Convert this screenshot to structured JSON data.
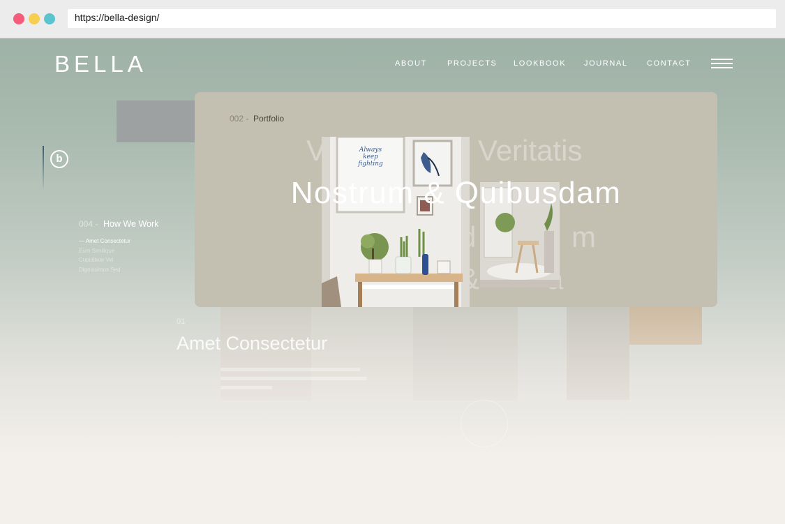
{
  "browser": {
    "url": "https://bella-design/",
    "dot_colors": [
      "#f45c7a",
      "#f7ce4f",
      "#5cc4cf"
    ]
  },
  "header": {
    "logo": "BELLA",
    "nav": [
      "ABOUT",
      "PROJECTS",
      "LOOKBOOK",
      "JOURNAL",
      "CONTACT"
    ],
    "menu_icon": "hamburger-icon"
  },
  "side": {
    "logo_letter": "b"
  },
  "how_we_work": {
    "number": "004 -",
    "title": "How We Work",
    "items": [
      "— Amet Consectetur",
      "Eum Similique",
      "Cupiditate Vel",
      "Dignissimos Sed"
    ]
  },
  "project": {
    "number": "01",
    "title": "Amet Consectetur"
  },
  "overlay": {
    "number": "002 -",
    "label": "Portfolio",
    "hero_title": "Nostrum & Quibusdam",
    "ghost_words": [
      "V",
      "Veritatis",
      "d",
      "m",
      "&",
      "a"
    ],
    "poster_text": [
      "Always",
      "keep",
      "fighting"
    ]
  },
  "colors": {
    "accent_bg": "#9fb2a7",
    "card_bg": "#c3c0b1",
    "page_bottom": "#f3f0ec"
  }
}
